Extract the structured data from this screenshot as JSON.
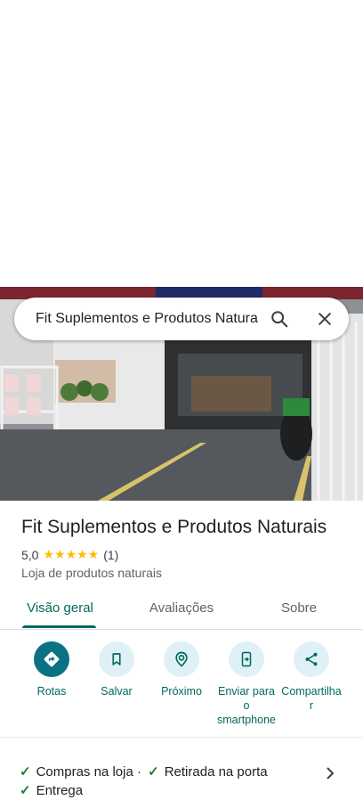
{
  "search": {
    "value": "Fit Suplementos e Produtos Naturais",
    "search_icon": "search-icon",
    "clear_icon": "close-icon"
  },
  "place": {
    "name": "Fit Suplementos e Produtos Naturais",
    "rating": "5,0",
    "stars": "★★★★★",
    "review_count": "(1)",
    "category": "Loja de produtos naturais"
  },
  "tabs": [
    {
      "label": "Visão geral",
      "active": true
    },
    {
      "label": "Avaliações",
      "active": false
    },
    {
      "label": "Sobre",
      "active": false
    }
  ],
  "actions": [
    {
      "label": "Rotas",
      "icon": "directions-icon"
    },
    {
      "label": "Salvar",
      "icon": "bookmark-icon"
    },
    {
      "label": "Próximo",
      "icon": "nearby-icon"
    },
    {
      "label": "Enviar para o smartphone",
      "label_lines": [
        "Enviar para",
        "o",
        "smartphone"
      ],
      "icon": "send-to-phone-icon"
    },
    {
      "label": "Compartilhar",
      "label_lines": [
        "Compartilha",
        "r"
      ],
      "icon": "share-icon"
    }
  ],
  "features": {
    "item1": "Compras na loja",
    "separator": "·",
    "item2": "Retirada na porta",
    "item3": "Entrega"
  },
  "colors": {
    "accent": "#00695c",
    "primary_button": "#0b7285",
    "action_bg": "#dff1f6",
    "star": "#fbbc04",
    "check": "#188038"
  }
}
